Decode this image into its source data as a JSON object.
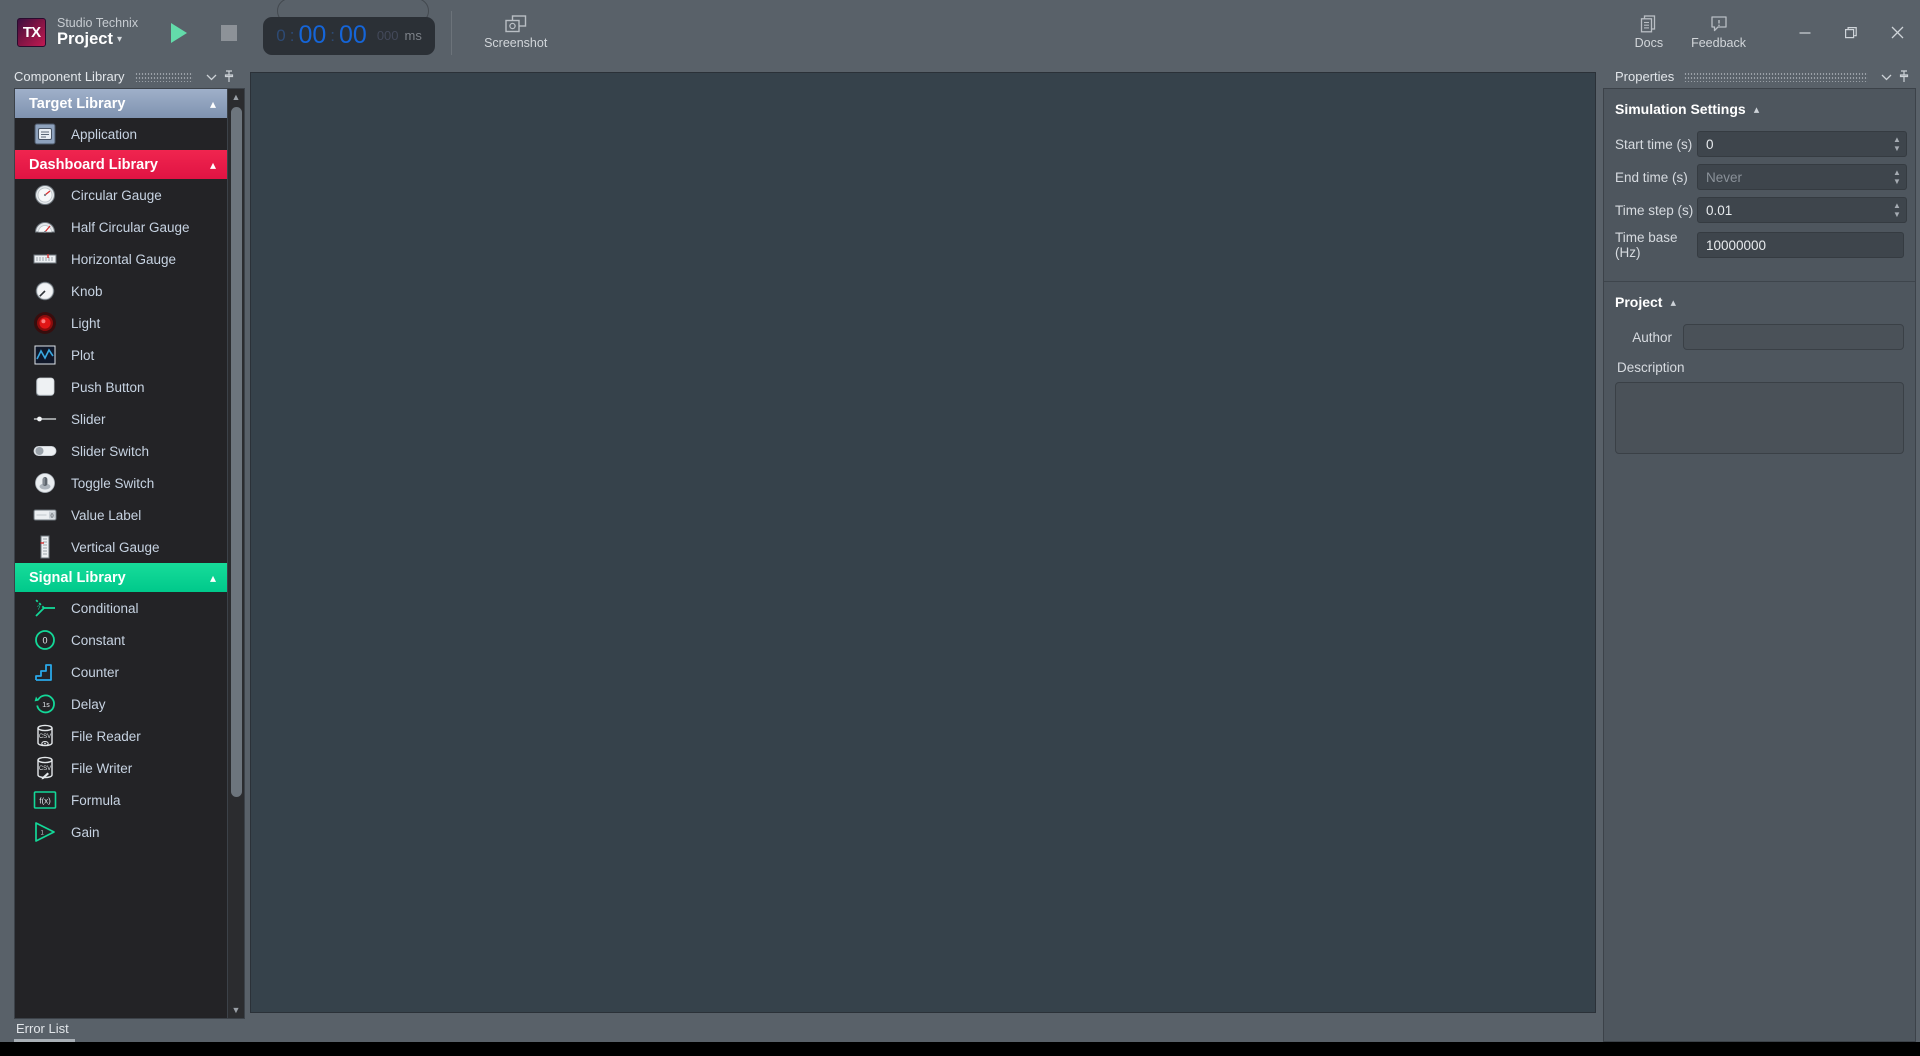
{
  "titlebar": {
    "logo_text": "TX",
    "brand_sub": "Studio Technix",
    "brand_main": "Project",
    "play_title": "Play",
    "stop_title": "Stop",
    "timer": {
      "hours": "0",
      "sep1": ":",
      "minutes": "00",
      "sep2": ":",
      "seconds": "00",
      "millis": "000",
      "unit": "ms"
    },
    "screenshot_label": "Screenshot",
    "docs_label": "Docs",
    "feedback_label": "Feedback",
    "minimize_label": "Minimize",
    "maximize_label": "Maximize",
    "close_label": "Close"
  },
  "left_panel": {
    "title": "Component Library",
    "sections": [
      {
        "name": "Target Library",
        "color": "#8194b1",
        "items": [
          {
            "label": "Application",
            "icon": "application-icon"
          }
        ]
      },
      {
        "name": "Dashboard Library",
        "color": "#e6164a",
        "items": [
          {
            "label": "Circular Gauge",
            "icon": "circular-gauge-icon"
          },
          {
            "label": "Half Circular Gauge",
            "icon": "half-circular-gauge-icon"
          },
          {
            "label": "Horizontal Gauge",
            "icon": "horizontal-gauge-icon"
          },
          {
            "label": "Knob",
            "icon": "knob-icon"
          },
          {
            "label": "Light",
            "icon": "light-icon"
          },
          {
            "label": "Plot",
            "icon": "plot-icon"
          },
          {
            "label": "Push Button",
            "icon": "push-button-icon"
          },
          {
            "label": "Slider",
            "icon": "slider-icon"
          },
          {
            "label": "Slider Switch",
            "icon": "slider-switch-icon"
          },
          {
            "label": "Toggle Switch",
            "icon": "toggle-switch-icon"
          },
          {
            "label": "Value Label",
            "icon": "value-label-icon"
          },
          {
            "label": "Vertical Gauge",
            "icon": "vertical-gauge-icon"
          }
        ]
      },
      {
        "name": "Signal Library",
        "color": "#00c98b",
        "items": [
          {
            "label": "Conditional",
            "icon": "conditional-icon"
          },
          {
            "label": "Constant",
            "icon": "constant-icon"
          },
          {
            "label": "Counter",
            "icon": "counter-icon"
          },
          {
            "label": "Delay",
            "icon": "delay-icon"
          },
          {
            "label": "File Reader",
            "icon": "file-reader-icon"
          },
          {
            "label": "File Writer",
            "icon": "file-writer-icon"
          },
          {
            "label": "Formula",
            "icon": "formula-icon"
          },
          {
            "label": "Gain",
            "icon": "gain-icon"
          }
        ]
      }
    ]
  },
  "error_bar": {
    "tab_label": "Error List"
  },
  "right_panel": {
    "title": "Properties",
    "simulation": {
      "heading": "Simulation Settings",
      "fields": [
        {
          "label": "Start time (s)",
          "value": "0",
          "placeholder": "",
          "spinner": true
        },
        {
          "label": "End time (s)",
          "value": "",
          "placeholder": "Never",
          "spinner": true
        },
        {
          "label": "Time step (s)",
          "value": "0.01",
          "placeholder": "",
          "spinner": true
        },
        {
          "label": "Time base (Hz)",
          "value": "10000000",
          "placeholder": "",
          "spinner": false
        }
      ]
    },
    "project": {
      "heading": "Project",
      "author_label": "Author",
      "author_value": "",
      "description_label": "Description",
      "description_value": ""
    }
  }
}
